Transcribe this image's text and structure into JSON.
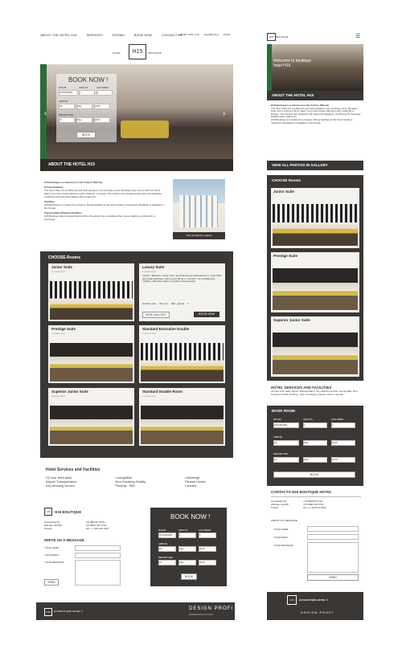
{
  "nav": {
    "items": [
      "ABOUT THE HOTEL H15",
      "SERVICES",
      "ROOMS",
      "BOOK NOW",
      "CONTACT US"
    ],
    "phone": "+48 887 1357 1710",
    "email": "hotel@h15.pl",
    "langs": "PL EN"
  },
  "logo": {
    "text": "H15",
    "left": "HOTEL",
    "right": "BOUTIQUE"
  },
  "hero": {
    "booking_title": "BOOK NOW !",
    "labels": {
      "room": "ROOM",
      "adults": "ADULTS",
      "children": "CHILDREN",
      "arrive": "ARRIVE",
      "departure": "DEPARTURE"
    },
    "values": {
      "room": "STANDARD",
      "adults": "1",
      "children": "1",
      "arrive_d": "18",
      "arrive_m": "May",
      "arrive_y": "2016",
      "dep_d": "21",
      "dep_m": "May",
      "dep_y": "2016"
    },
    "book_label": "BOOK",
    "about_label": "ABOUT THE HOTEL H15"
  },
  "about": {
    "heading": "H15 Boutique is a luxurious 5-star hotel in Warsaw",
    "accommodation_title": "Accommodation",
    "accommodation_text": "The hotel offers air-conditioned and well-equipped, non-smoking rooms. Boutique style rooms with free Wi-Fi. Each room has a large bathroom with a bathtub or shower. The interiors are designed with taste and elegance, combining the historical building with modern art.",
    "facilities_title": "Facilities",
    "facilities_text": "H15 Boutique is a smoke-free property. Dining facilities at the hotel include a restaurant. Breakfast is available in the lounge.",
    "transport_title": "Transportation/Parking Facilities",
    "transport_text": "H15 Boutique offers transportation to/from the airport for an additional fee. Guest parking is offered for a surcharge.",
    "gallery_caption": "View all photos in gallery"
  },
  "rooms": {
    "heading": "CHOOSE Rooms",
    "items": [
      {
        "name": "Junior Suite",
        "sub": "1 queen bed",
        "more": "more"
      },
      {
        "name": "Luxury Suite",
        "sub": "1 queen bed",
        "more": "more",
        "desc": "Layout - Bedroom, living room, and dining area. Entertainment - Free WiFi and smart television. Rooms are 55 sq m. Comfort - Air conditioning, minibar, coffee/tea maker and daily housekeeping.",
        "meta1": "Surface area",
        "meta2": "55 sq m",
        "meta3": "Max. guests",
        "meta4": "2",
        "gallery": "VIEW GALLERY",
        "book": "BOOK NOW"
      },
      {
        "name": "Prestige Suite",
        "sub": "1 queen bed",
        "more": "more"
      },
      {
        "name": "Standard Executive Double",
        "sub": "1 queen bed",
        "more": "more"
      },
      {
        "name": "Superior Junior Suite",
        "sub": "1 queen bed",
        "more": "more"
      },
      {
        "name": "Standard Double Room",
        "sub": "1 queen bed",
        "more": "more"
      }
    ]
  },
  "services": {
    "heading": "Hotel Services and Facilities",
    "col1": [
      "24 hour front desk",
      "Airport Transportation",
      "Dry cleaning service"
    ],
    "col2": [
      "Lounge/Bar",
      "Non-Smoking Facility",
      "Parking - Self"
    ],
    "col3": [
      "Concierge",
      "Fitness Center",
      "Laundry"
    ]
  },
  "contact": {
    "brand": "H15 BOUTIQUE",
    "address": [
      "Poznańska 15,",
      "Warsaw, 00-680,",
      "Poland"
    ],
    "phones": [
      "US 888-657-3791",
      "UK 0808 145 3715",
      "EU + 1 403-610-3611"
    ],
    "write_title": "WRITE US A MESSAGE",
    "name_label": "YOUR NAME:",
    "email_label": "YOUR EMAIL:",
    "message_label": "YOUR MESSAGE:",
    "send_label": "SEND"
  },
  "footer": {
    "brand": "H15 BOUTIQUE HOTEL ©",
    "credit": "DESIGN PROFI",
    "credit_sub": "WEBDESIGN STUDIO"
  },
  "mobile": {
    "hero_title": "Welcome to boutique hotel H15",
    "about_label": "ABOUT THE HOTEL H15",
    "gallery_label": "VIEW ALL PHOTOS IN GALLERY",
    "rooms_label": "CHOOSE Rooms",
    "rooms": [
      "Junior Suite",
      "Prestige Suite",
      "Superior Junior Suite"
    ],
    "services_title": "HOTEL SERVICES AND FACILITIES",
    "services_text": "24 hour front desk, Airport Transportation, Dry cleaning service, Lounge/Bar, Non-Smoking Facility, Parking - Self, Concierge, Fitness Center, Laundry",
    "book_room": "BOOK ROOM",
    "contacts_title": "CONTACTS H15 BOUTIQUE HOTEL",
    "footer_brand": "H15 BOUTIQUE HOTEL ©"
  }
}
